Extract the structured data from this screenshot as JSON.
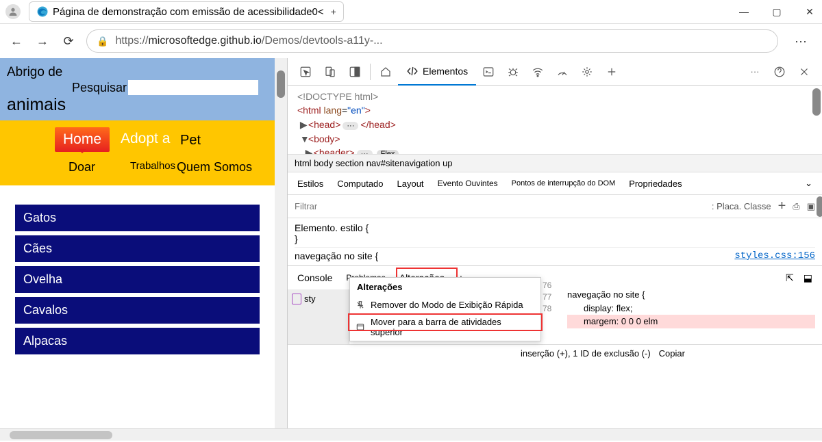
{
  "browser": {
    "tab_title": "Página de demonstração com emissão de acessibilidade0<",
    "tab_close": "+",
    "win_min": "—",
    "win_max": "▢",
    "win_close": "✕",
    "url_prefix": "https://",
    "url_host": "microsoftedge.github.io",
    "url_path": "/Demos/devtools-a11y-...",
    "more": "···"
  },
  "page": {
    "title1": "Abrigo de",
    "title2": "animais",
    "search_label": "Pesquisar",
    "nav": {
      "home": "Home",
      "adopt": "Adopt a",
      "pet": "Pet",
      "doar": "Doar",
      "trabalhos": "Trabalhos",
      "quem": "Quem Somos"
    },
    "categories": [
      "Gatos",
      "Cães",
      "Ovelha",
      "Cavalos",
      "Alpacas"
    ]
  },
  "devtools": {
    "elements_tab": "Elementos",
    "dom": {
      "doctype": "<!DOCTYPE html>",
      "html_open": "<html ",
      "lang_attr": "lang",
      "lang_eq": "=",
      "lang_val": "\"en\"",
      "html_close": ">",
      "head_open": "<head>",
      "head_close": "</head>",
      "body_open": "<body>",
      "header_open": "<header>",
      "flex_badge": "Flex"
    },
    "breadcrumb": "html body section nav#sitenavigation up",
    "tabs2": {
      "estilos": "Estilos",
      "computado": "Computado",
      "layout": "Layout",
      "evento": "Evento Ouvintes",
      "dom_bp": "Pontos de interrupção do DOM",
      "props": "Propriedades"
    },
    "filter": {
      "placeholder": "Filtrar",
      "placa": ": Placa. Classe"
    },
    "styles": {
      "element_rule": "Elemento. estilo {",
      "close": "}",
      "nav_rule": "navegação no site {",
      "link": "styles.css:156"
    },
    "drawer": {
      "console": "Console",
      "problemas": "Problemas",
      "alteracoes": "Alterações",
      "plus": "+",
      "file": "sty",
      "menu_title": "Alterações",
      "menu_remove": "Remover do Modo de Exibição Rápida",
      "menu_move": "Mover para a barra de atividades superior",
      "line76": "76",
      "line77": "77",
      "line78": "78",
      "code_nav": "navegação no site {",
      "code_display": "display: flex;",
      "code_margin": "margem: 0 0 0 elm",
      "footer": "inserção (+), 1 ID de exclusão (-)",
      "copy": "Copiar"
    }
  }
}
